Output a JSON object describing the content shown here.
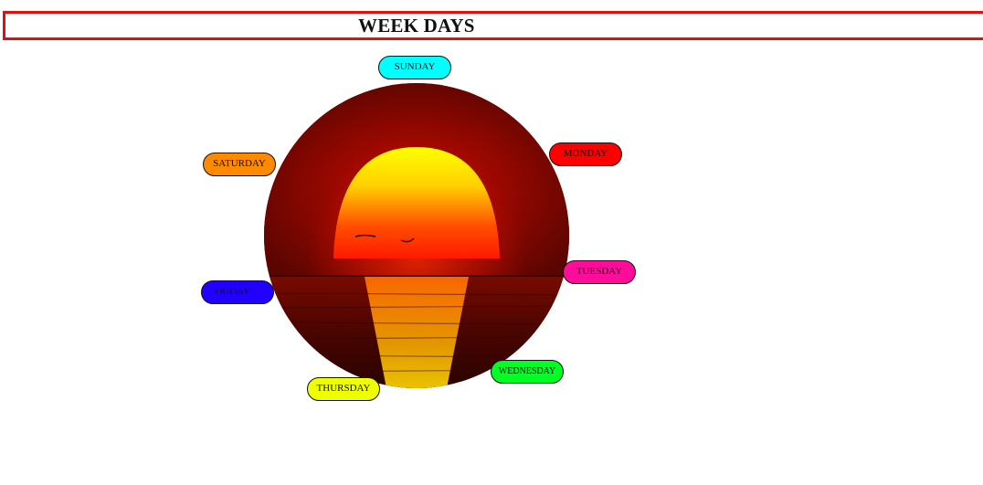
{
  "header": {
    "title": "WEEK DAYS",
    "border_color": "#e01010"
  },
  "image": {
    "description_icon": "sunset-over-sea-image"
  },
  "days": [
    {
      "id": "sunday",
      "label": "SUNDAY",
      "color": "#00ffff"
    },
    {
      "id": "monday",
      "label": "MONDAY",
      "color": "#ff0000"
    },
    {
      "id": "tuesday",
      "label": "TUESDAY",
      "color": "#ff0c9a"
    },
    {
      "id": "wednesday",
      "label": "WEDNESDAY",
      "color": "#00ff22"
    },
    {
      "id": "thursday",
      "label": "THURSDAY",
      "color": "#eeff00"
    },
    {
      "id": "friday",
      "label": "FRIDAY",
      "color": "#2200ff"
    },
    {
      "id": "saturday",
      "label": "SATURDAY",
      "color": "#ff8a00"
    }
  ]
}
